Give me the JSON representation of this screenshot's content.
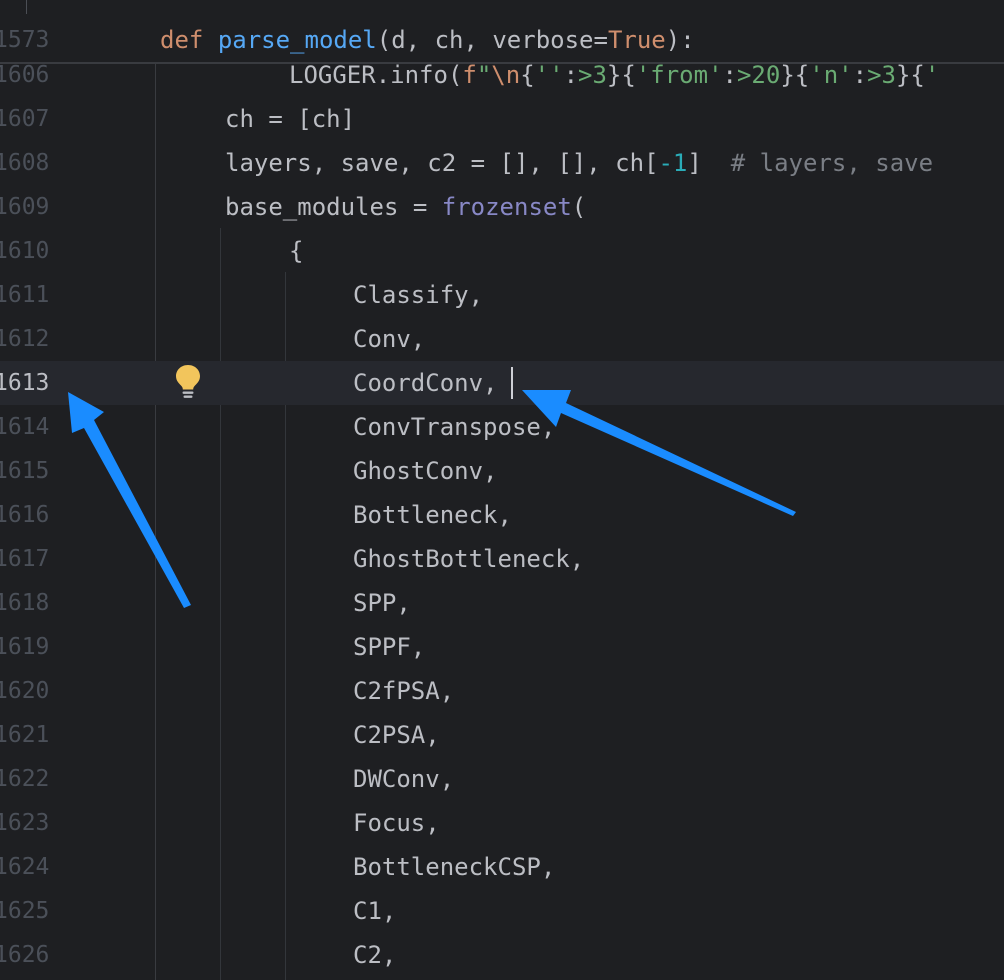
{
  "editor": {
    "sticky_header": {
      "line_number": "1573",
      "code": [
        {
          "t": "def",
          "c": "kw"
        },
        {
          "t": " "
        },
        {
          "t": "parse_model",
          "c": "fn"
        },
        {
          "t": "(d, ch, verbose="
        },
        {
          "t": "True",
          "c": "kw"
        },
        {
          "t": "):"
        }
      ]
    },
    "current_line": "1613",
    "lines": [
      {
        "n": "1606",
        "indent": 2,
        "code": [
          {
            "t": "LOGGER.info("
          },
          {
            "t": "f",
            "c": "kw"
          },
          {
            "t": "\"",
            "c": "str"
          },
          {
            "t": "\\n",
            "c": "kw"
          },
          {
            "t": "{"
          },
          {
            "t": "''",
            "c": "str"
          },
          {
            "t": ":"
          },
          {
            "t": ">3",
            "c": "str"
          },
          {
            "t": "}{"
          },
          {
            "t": "'from'",
            "c": "str"
          },
          {
            "t": ":"
          },
          {
            "t": ">20",
            "c": "str"
          },
          {
            "t": "}{"
          },
          {
            "t": "'n'",
            "c": "str"
          },
          {
            "t": ":"
          },
          {
            "t": ">3",
            "c": "str"
          },
          {
            "t": "}{"
          },
          {
            "t": "'",
            "c": "str"
          }
        ]
      },
      {
        "n": "1607",
        "indent": 1,
        "code": [
          {
            "t": "ch = [ch]"
          }
        ]
      },
      {
        "n": "1608",
        "indent": 1,
        "code": [
          {
            "t": "layers, save, c2 = [], [], ch["
          },
          {
            "t": "-1",
            "c": "num"
          },
          {
            "t": "]  "
          },
          {
            "t": "# layers, save",
            "c": "cmt"
          }
        ]
      },
      {
        "n": "1609",
        "indent": 1,
        "code": [
          {
            "t": "base_modules = "
          },
          {
            "t": "frozenset",
            "c": "builtin"
          },
          {
            "t": "("
          }
        ]
      },
      {
        "n": "1610",
        "indent": 2,
        "code": [
          {
            "t": "{"
          }
        ]
      },
      {
        "n": "1611",
        "indent": 3,
        "code": [
          {
            "t": "Classify,"
          }
        ]
      },
      {
        "n": "1612",
        "indent": 3,
        "code": [
          {
            "t": "Conv,"
          }
        ]
      },
      {
        "n": "1613",
        "indent": 3,
        "code": [
          {
            "t": "CoordConv,"
          }
        ]
      },
      {
        "n": "1614",
        "indent": 3,
        "code": [
          {
            "t": "ConvTranspose,"
          }
        ]
      },
      {
        "n": "1615",
        "indent": 3,
        "code": [
          {
            "t": "GhostConv,"
          }
        ]
      },
      {
        "n": "1616",
        "indent": 3,
        "code": [
          {
            "t": "Bottleneck,"
          }
        ]
      },
      {
        "n": "1617",
        "indent": 3,
        "code": [
          {
            "t": "GhostBottleneck,"
          }
        ]
      },
      {
        "n": "1618",
        "indent": 3,
        "code": [
          {
            "t": "SPP,"
          }
        ]
      },
      {
        "n": "1619",
        "indent": 3,
        "code": [
          {
            "t": "SPPF,"
          }
        ]
      },
      {
        "n": "1620",
        "indent": 3,
        "code": [
          {
            "t": "C2fPSA,"
          }
        ]
      },
      {
        "n": "1621",
        "indent": 3,
        "code": [
          {
            "t": "C2PSA,"
          }
        ]
      },
      {
        "n": "1622",
        "indent": 3,
        "code": [
          {
            "t": "DWConv,"
          }
        ]
      },
      {
        "n": "1623",
        "indent": 3,
        "code": [
          {
            "t": "Focus,"
          }
        ]
      },
      {
        "n": "1624",
        "indent": 3,
        "code": [
          {
            "t": "BottleneckCSP,"
          }
        ]
      },
      {
        "n": "1625",
        "indent": 3,
        "code": [
          {
            "t": "C1,"
          }
        ]
      },
      {
        "n": "1626",
        "indent": 3,
        "code": [
          {
            "t": "C2,"
          }
        ]
      }
    ]
  },
  "colors": {
    "background": "#1e1f22",
    "current_line": "#26282e",
    "keyword": "#cf8e6d",
    "function": "#56a8f5",
    "builtin": "#8888c6",
    "string": "#6aab73",
    "number": "#2aacb8",
    "comment": "#7a7e85",
    "annotation_arrow": "#1e90ff",
    "bulb": "#f2c55c"
  },
  "icons": {
    "intention": "lightbulb-icon",
    "annotation": "arrow-annotation"
  }
}
